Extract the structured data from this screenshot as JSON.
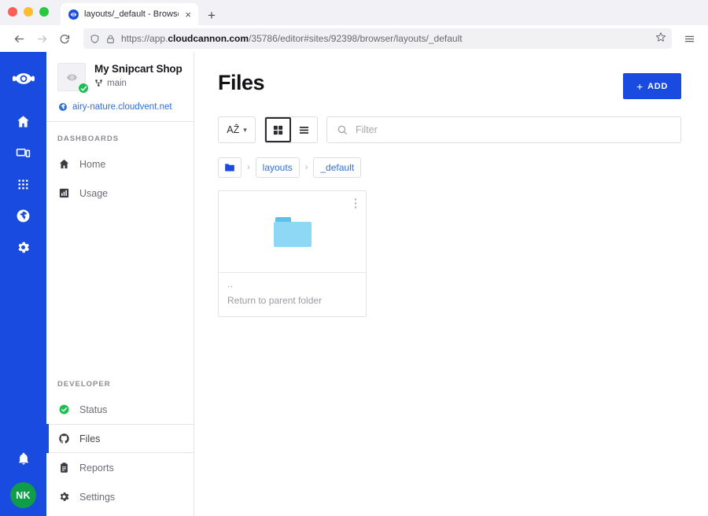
{
  "browser": {
    "tab": {
      "title": "layouts/_default - Browser - My",
      "favicon": "cloudcannon-icon",
      "close": "×"
    },
    "new_tab_label": "+",
    "nav": {
      "back": "back-icon",
      "forward": "forward-icon",
      "reload": "reload-icon"
    },
    "url": {
      "scheme": "https://app.",
      "domain": "cloudcannon.com",
      "path": "/35786/editor#sites/92398/browser/layouts/_default",
      "full": "https://app.cloudcannon.com/35786/editor#sites/92398/browser/layouts/_default"
    },
    "shield_icon": "shield-icon",
    "lock_icon": "lock-icon",
    "bookmark_icon": "star-icon",
    "menu_icon": "hamburger-menu-icon"
  },
  "rail": {
    "logo": "cloudcannon-logo",
    "items": [
      {
        "name": "home",
        "icon": "home-icon"
      },
      {
        "name": "devices",
        "icon": "devices-icon"
      },
      {
        "name": "apps",
        "icon": "grid-apps-icon"
      },
      {
        "name": "globe",
        "icon": "globe-icon"
      },
      {
        "name": "settings",
        "icon": "gear-icon"
      }
    ],
    "bell": "bell-icon",
    "avatar_initials": "NK",
    "avatar_color": "#0f9d48"
  },
  "sidebar": {
    "site": {
      "name": "My Snipcart Shop",
      "branch": "main",
      "branch_icon": "branch-icon",
      "status_badge": "check-icon",
      "thumb_icon": "cloudcannon-eye-icon",
      "url": "airy-nature.cloudvent.net",
      "url_icon": "globe-icon"
    },
    "sections": [
      {
        "label": "DASHBOARDS",
        "items": [
          {
            "label": "Home",
            "icon": "home-icon",
            "active": false
          },
          {
            "label": "Usage",
            "icon": "chart-bar-icon",
            "active": false
          }
        ]
      },
      {
        "label": "DEVELOPER",
        "items": [
          {
            "label": "Status",
            "icon": "status-check-icon",
            "active": false
          },
          {
            "label": "Files",
            "icon": "github-icon",
            "active": true
          },
          {
            "label": "Reports",
            "icon": "clipboard-icon",
            "active": false
          },
          {
            "label": "Settings",
            "icon": "gear-icon",
            "active": false
          }
        ]
      }
    ]
  },
  "main": {
    "title": "Files",
    "add_button": {
      "label": "ADD",
      "plus": "+",
      "color": "#1a4be0"
    },
    "controls": {
      "sort_label": "AẐ",
      "sort_caret": "ⱟ",
      "view_grid_icon": "grid-view-icon",
      "view_list_icon": "list-view-icon",
      "active_view": "grid",
      "filter_placeholder": "Filter",
      "filter_value": "",
      "search_icon": "search-icon"
    },
    "breadcrumb": {
      "root_icon": "folder-icon",
      "separator": "›",
      "items": [
        {
          "label": "layouts"
        },
        {
          "label": "_default"
        }
      ]
    },
    "files": [
      {
        "name": "..",
        "description": "Return to parent folder",
        "icon": "folder-icon",
        "folder_tab_color": "#5ec1ea",
        "folder_body_color": "#8ed7f5",
        "menu_icon": "kebab-menu-icon"
      }
    ]
  }
}
